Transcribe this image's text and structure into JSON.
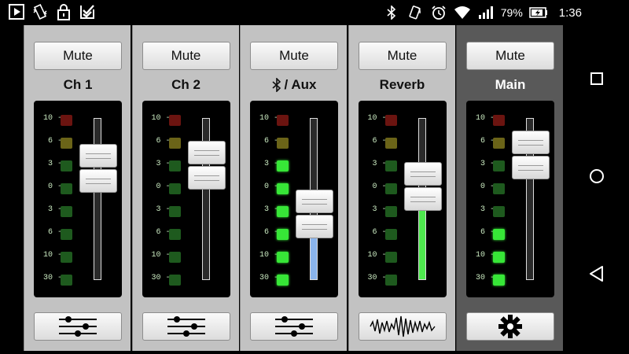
{
  "status_bar": {
    "battery": "79%",
    "time": "1:36",
    "icons_left": [
      "play-store-icon",
      "vibrate-icon",
      "lock-icon",
      "tasks-icon"
    ],
    "icons_right": [
      "bluetooth-icon",
      "nfc-icon",
      "alarm-icon",
      "wifi-icon",
      "signal-icon",
      "battery-icon"
    ]
  },
  "led_scale": [
    "10",
    "6",
    "3",
    "0",
    "3",
    "6",
    "10",
    "30"
  ],
  "colors": {
    "led_green_on": "#37e637",
    "led_green_off": "#1e5a1e",
    "led_yellow_off": "#6b6418",
    "led_red_off": "#6b1410",
    "aux_fill": "#8ab4ec",
    "reverb_fill": "#4ee84e"
  },
  "channels": [
    {
      "label": "Ch 1",
      "mute_label": "Mute",
      "fader_level": 0.69,
      "meter_lit": 0,
      "fill_color": "",
      "bottom_icon": "eq-sliders-icon"
    },
    {
      "label": "Ch 2",
      "mute_label": "Mute",
      "fader_level": 0.71,
      "meter_lit": 0,
      "fill_color": "",
      "bottom_icon": "eq-sliders-icon"
    },
    {
      "label": "/ Aux",
      "label_icon": "bluetooth-icon",
      "mute_label": "Mute",
      "fader_level": 0.41,
      "meter_lit": 6,
      "fill_color": "#8ab4ec",
      "bottom_icon": "eq-sliders-icon"
    },
    {
      "label": "Reverb",
      "mute_label": "Mute",
      "fader_level": 0.58,
      "meter_lit": 0,
      "fill_color": "#4ee84e",
      "bottom_icon": "waveform-icon"
    },
    {
      "label": "Main",
      "mute_label": "Mute",
      "fader_level": 0.77,
      "meter_lit": 3,
      "fill_color": "",
      "bottom_icon": "gear-icon"
    }
  ],
  "nav": [
    "recents-button",
    "home-button",
    "back-button"
  ]
}
